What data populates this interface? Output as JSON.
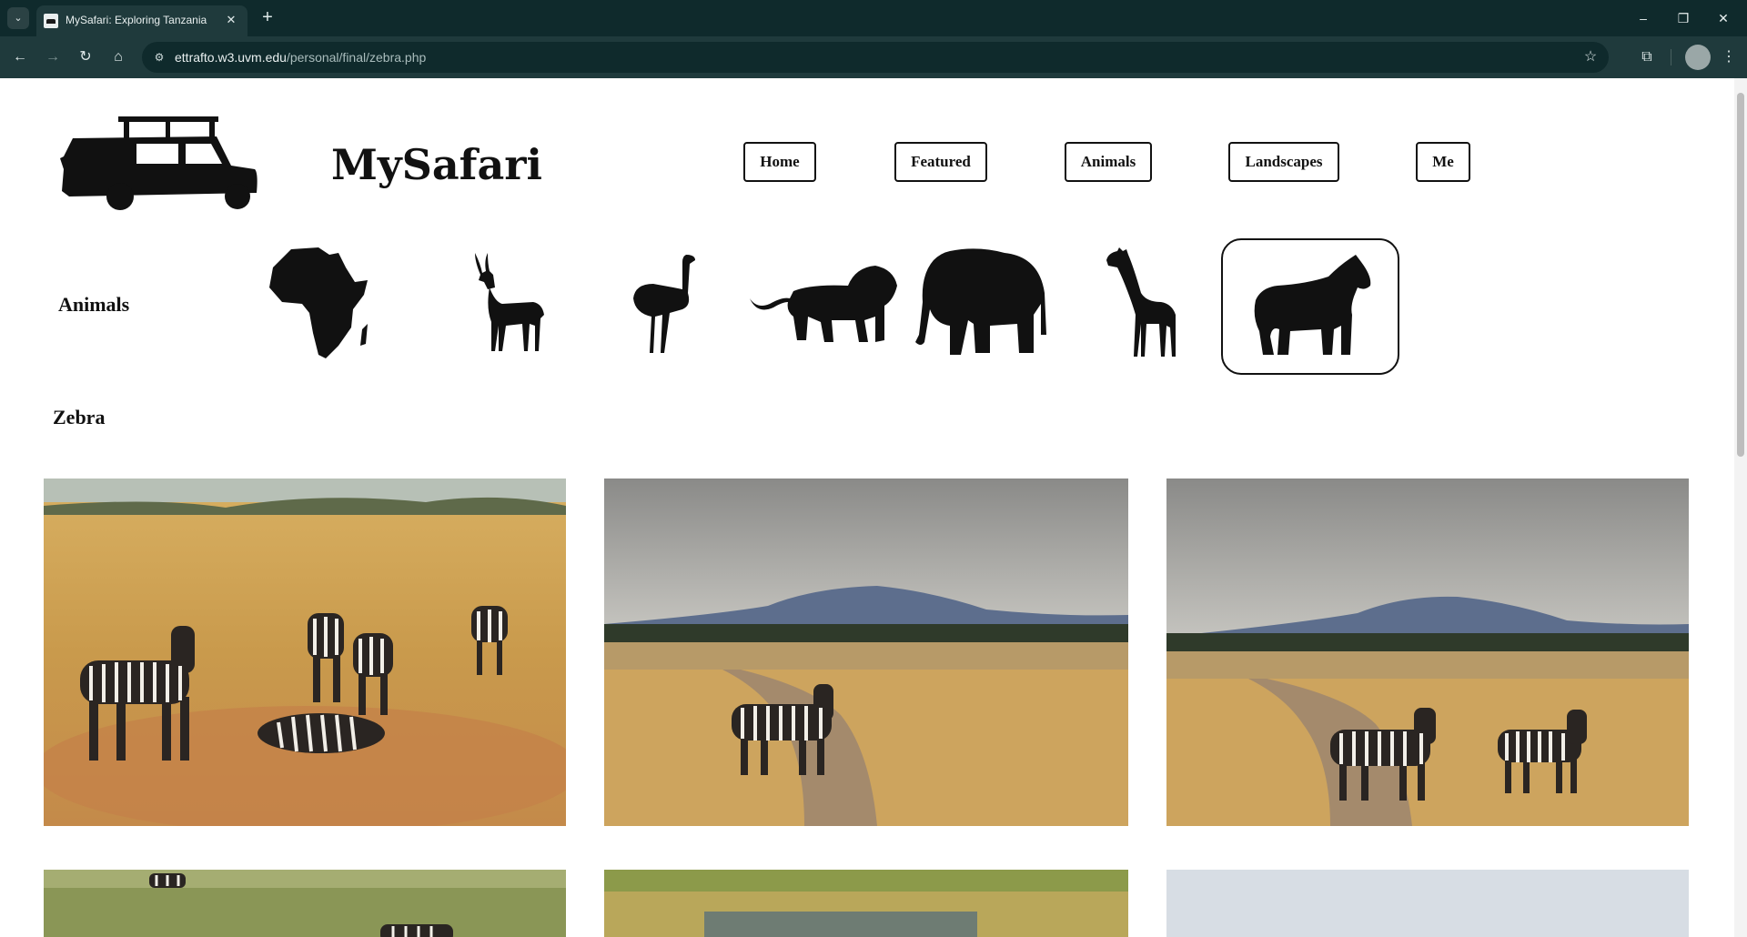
{
  "browser": {
    "tab_title": "MySafari: Exploring Tanzania",
    "url_host": "ettrafto.w3.uvm.edu",
    "url_path": "/personal/final/zebra.php"
  },
  "site": {
    "title": "MySafari"
  },
  "nav": {
    "items": [
      "Home",
      "Featured",
      "Animals",
      "Landscapes",
      "Me"
    ]
  },
  "animals_section": {
    "label": "Animals",
    "icons": [
      "africa-map-icon",
      "gazelle-icon",
      "ostrich-icon",
      "lion-icon",
      "elephant-icon",
      "giraffe-icon",
      "zebra-icon"
    ],
    "selected": "zebra-icon"
  },
  "page": {
    "heading": "Zebra"
  },
  "colors": {
    "chrome_dark": "#0f2a2c",
    "chrome_mid": "#1f3a3c",
    "text": "#111111"
  }
}
